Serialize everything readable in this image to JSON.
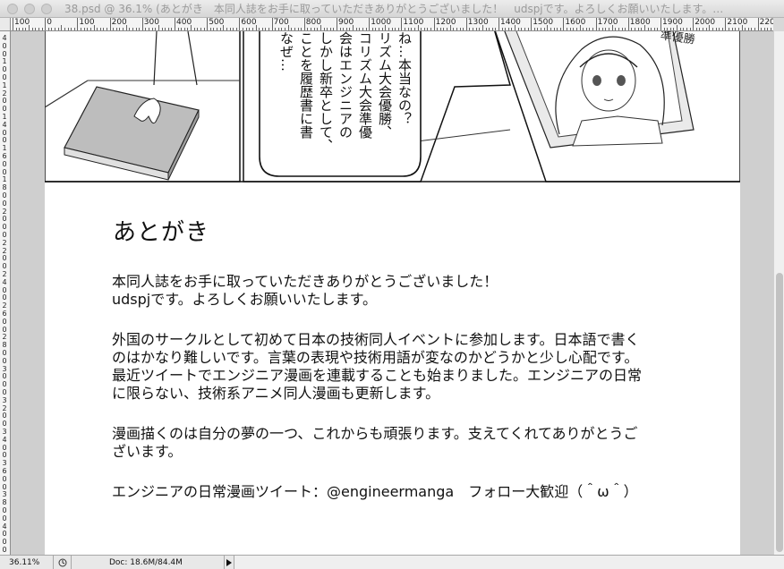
{
  "window": {
    "title": "38.psd @ 36.1% (あとがき　本同人誌をお手に取っていただきありがとうございました！　udspjです。よろしくお願いいたします。…"
  },
  "ruler": {
    "h_labels": [
      "100",
      "0",
      "100",
      "200",
      "300",
      "400",
      "500",
      "600",
      "700",
      "800",
      "900",
      "1000",
      "1100",
      "1200",
      "1300",
      "1400",
      "1500",
      "1600",
      "1700",
      "1800",
      "1900",
      "2000",
      "2100",
      "220"
    ],
    "v_labels": [
      "4",
      "0",
      "0",
      "1",
      "0",
      "0",
      "1",
      "2",
      "0",
      "0",
      "1",
      "4",
      "0",
      "0",
      "1",
      "6",
      "0",
      "0",
      "1",
      "8",
      "0",
      "0",
      "2",
      "0",
      "0",
      "0",
      "2",
      "2",
      "0",
      "0",
      "2",
      "4",
      "0",
      "0",
      "2",
      "6",
      "0",
      "0",
      "2",
      "8",
      "0",
      "0",
      "3",
      "0",
      "0",
      "0",
      "3",
      "2",
      "0",
      "0",
      "3",
      "4",
      "0",
      "0",
      "3",
      "6",
      "0",
      "0",
      "3",
      "8",
      "0",
      "0",
      "4",
      "0",
      "0",
      "0"
    ]
  },
  "manga": {
    "speech_column_1": "なぜ…",
    "speech_column_2": "ことを履歴書に書",
    "speech_column_3": "しかし新卒として、",
    "speech_column_4": "会はエンジニアの",
    "speech_column_5": "コリズム大会準優",
    "speech_column_6": "リズム大会優勝、",
    "speech_column_7": "ね…本当なの？",
    "corner_text": "準優勝"
  },
  "afterword": {
    "title": "あとがき",
    "p1": "本同人誌をお手に取っていただきありがとうございました！\nudspjです。よろしくお願いいたします。",
    "p2": "外国のサークルとして初めて日本の技術同人イベントに参加します。日本語で書く\nのはかなり難しいです。言葉の表現や技術用語が変なのかどうかと少し心配です。\n最近ツイートでエンジニア漫画を連載することも始まりました。エンジニアの日常\nに限らない、技術系アニメ同人漫画も更新します。",
    "p3": "漫画描くのは自分の夢の一つ、これからも頑張ります。支えてくれてありがとうご\nざいます。",
    "p4": "エンジニアの日常漫画ツイート：@engineermanga　フォロー大歓迎（＾ω＾）"
  },
  "status": {
    "zoom": "36.11%",
    "doc": "Doc: 18.6M/84.4M"
  }
}
